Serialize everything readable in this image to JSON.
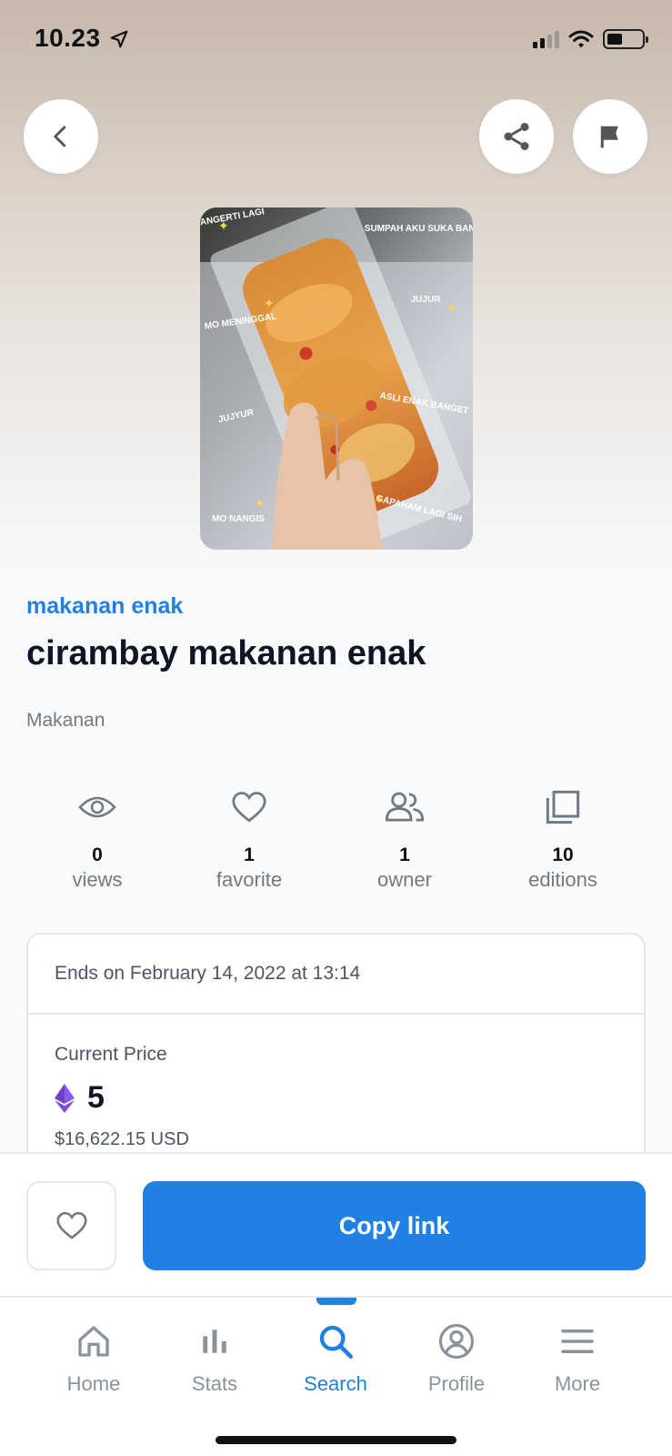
{
  "status_bar": {
    "time": "10.23"
  },
  "colors": {
    "accent": "#2081e2",
    "muted": "#707a83",
    "eth_purple": "#6f42c1"
  },
  "header": {
    "back_icon": "chevron-left-icon",
    "share_icon": "share-icon",
    "report_icon": "flag-icon"
  },
  "artwork": {
    "captions": {
      "c1": "GANGERTI LAGI",
      "c2": "SUMPAH AKU SUKA BANGET",
      "c3": "MO MENINGGAL",
      "c4": "JUJUR",
      "c5": "JUJYUR",
      "c6": "ASLI ENAK BANGET",
      "c7": "MO NANGIS",
      "c8": "GAPAHAM LAGI SIH"
    }
  },
  "item": {
    "collection": "makanan enak",
    "title": "cirambay makanan enak",
    "description": "Makanan"
  },
  "stats": [
    {
      "icon": "eye-icon",
      "value": "0",
      "label": "views"
    },
    {
      "icon": "heart-icon",
      "value": "1",
      "label": "favorite"
    },
    {
      "icon": "users-icon",
      "value": "1",
      "label": "owner"
    },
    {
      "icon": "copies-icon",
      "value": "10",
      "label": "editions"
    }
  ],
  "price": {
    "ends": "Ends on February 14, 2022 at 13:14",
    "label": "Current Price",
    "value": "5",
    "usd": "$16,622.15 USD",
    "currency_icon": "ethereum-icon"
  },
  "actions": {
    "favorite_icon": "heart-icon",
    "copy_label": "Copy link"
  },
  "tabs": [
    {
      "label": "Home",
      "icon": "home-icon"
    },
    {
      "label": "Stats",
      "icon": "bar-chart-icon"
    },
    {
      "label": "Search",
      "icon": "search-icon",
      "active": true
    },
    {
      "label": "Profile",
      "icon": "profile-icon"
    },
    {
      "label": "More",
      "icon": "menu-icon"
    }
  ]
}
